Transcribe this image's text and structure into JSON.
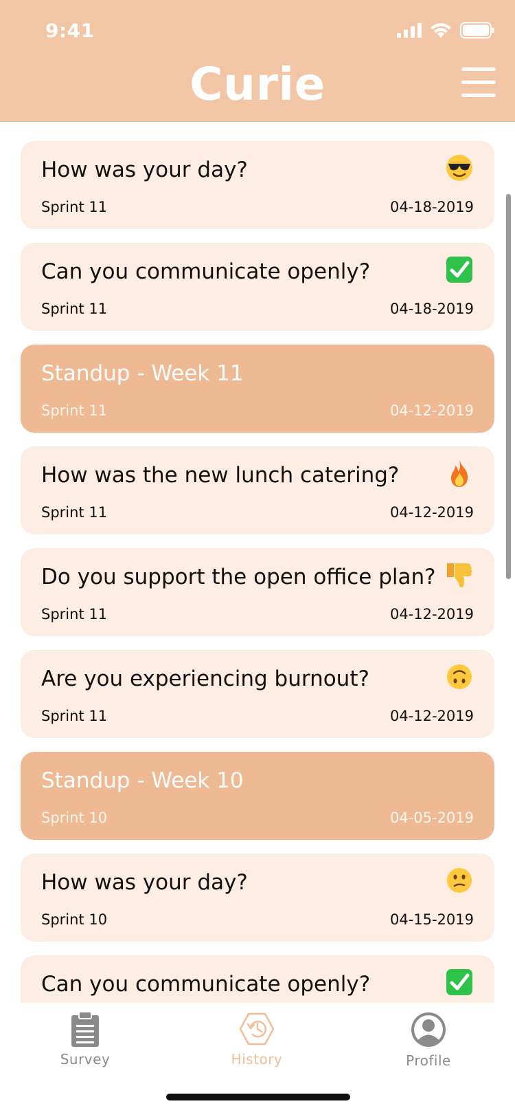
{
  "status_bar": {
    "time": "9:41"
  },
  "header": {
    "title": "Curie"
  },
  "colors": {
    "header": "#F2C5A5",
    "card": "#FDEDE2",
    "standup_card": "#EEB993",
    "accent": "#F1BE97"
  },
  "items": [
    {
      "title": "How was your day?",
      "sprint": "Sprint 11",
      "date": "04-18-2019",
      "emoji": "smiling-face-with-sunglasses"
    },
    {
      "title": "Can you communicate openly?",
      "sprint": "Sprint 11",
      "date": "04-18-2019",
      "emoji": "check-mark-button"
    },
    {
      "title": "Standup - Week 11",
      "sprint": "Sprint 11",
      "date": "04-12-2019",
      "emoji": ""
    },
    {
      "title": "How was the new lunch catering?",
      "sprint": "Sprint 11",
      "date": "04-12-2019",
      "emoji": "fire"
    },
    {
      "title": "Do you support the open office plan?",
      "sprint": "Sprint 11",
      "date": "04-12-2019",
      "emoji": "thumbs-down"
    },
    {
      "title": "Are you experiencing burnout?",
      "sprint": "Sprint 11",
      "date": "04-12-2019",
      "emoji": "upside-down-face"
    },
    {
      "title": "Standup - Week 10",
      "sprint": "Sprint 10",
      "date": "04-05-2019",
      "emoji": ""
    },
    {
      "title": "How was your day?",
      "sprint": "Sprint 10",
      "date": "04-15-2019",
      "emoji": "confused-face"
    },
    {
      "title": "Can you communicate openly?",
      "sprint": "",
      "date": "",
      "emoji": "check-mark-button"
    }
  ],
  "tabs": [
    {
      "label": "Survey",
      "icon": "clipboard-icon"
    },
    {
      "label": "History",
      "icon": "history-icon"
    },
    {
      "label": "Profile",
      "icon": "profile-icon"
    }
  ]
}
